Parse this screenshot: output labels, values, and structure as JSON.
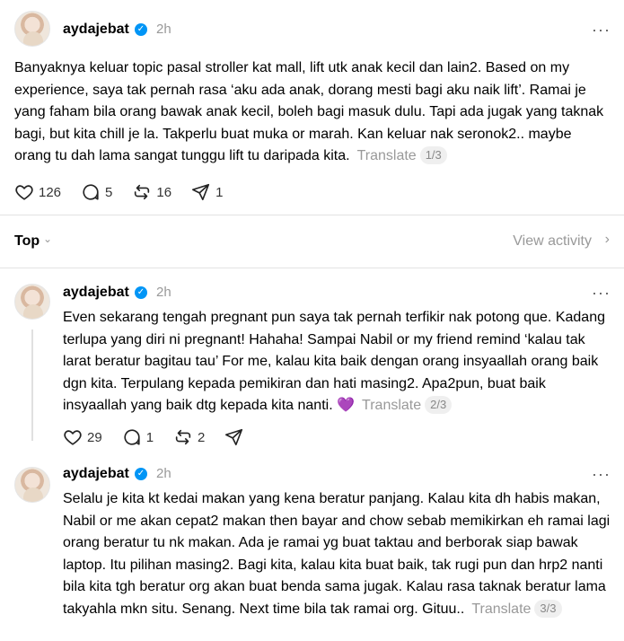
{
  "posts": [
    {
      "username": "aydajebat",
      "time": "2h",
      "text": "Banyaknya keluar topic pasal stroller kat mall, lift utk anak kecil dan lain2. Based on my experience, saya tak pernah rasa ‘aku ada anak, dorang mesti bagi aku naik lift’. Ramai je yang faham bila orang bawak anak kecil, boleh bagi masuk dulu. Tapi ada jugak yang taknak bagi, but kita chill je la. Takperlu buat muka or marah. Kan keluar nak seronok2.. maybe orang tu dah lama sangat tunggu lift tu daripada kita.",
      "translate": "Translate",
      "badge": "1/3",
      "likes": "126",
      "comments": "5",
      "reposts": "16",
      "shares": "1"
    },
    {
      "username": "aydajebat",
      "time": "2h",
      "text": "Even sekarang tengah pregnant pun saya tak pernah terfikir nak potong que. Kadang terlupa yang diri ni pregnant! Hahaha! Sampai Nabil or my friend remind ‘kalau tak larat beratur bagitau tau’ For me, kalau kita baik dengan orang insyaallah orang baik dgn kita. Terpulang kepada pemikiran dan hati masing2. Apa2pun, buat baik insyaallah yang baik dtg kepada kita nanti.",
      "emoji": "💜",
      "translate": "Translate",
      "badge": "2/3",
      "likes": "29",
      "comments": "1",
      "reposts": "2"
    },
    {
      "username": "aydajebat",
      "time": "2h",
      "text": "Selalu je kita kt kedai makan yang kena beratur panjang. Kalau kita dh habis makan, Nabil or me akan cepat2 makan then bayar and chow sebab memikirkan eh ramai lagi orang beratur tu nk makan. Ada je ramai yg buat taktau and berborak siap bawak laptop. Itu pilihan masing2. Bagi kita, kalau kita buat baik, tak rugi pun dan hrp2 nanti bila kita tgh beratur org akan buat benda sama jugak. Kalau rasa taknak beratur lama takyahla mkn situ. Senang. Next time bila tak ramai org. Gituu..",
      "translate": "Translate",
      "badge": "3/3"
    }
  ],
  "sort": {
    "label": "Top",
    "view_activity": "View activity"
  },
  "icons": {
    "more": "more-icon",
    "like": "heart-icon",
    "comment": "comment-icon",
    "repost": "repost-icon",
    "share": "share-icon",
    "verified": "verified-badge-icon"
  },
  "colors": {
    "verified": "#0095f6",
    "muted": "#999999"
  }
}
